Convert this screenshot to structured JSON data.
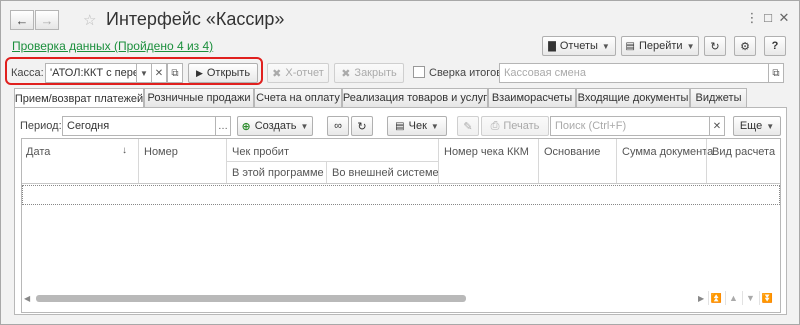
{
  "window": {
    "title": "Интерфейс «Кассир»",
    "back_icon": "arrow-left-icon",
    "forward_icon": "arrow-right-icon",
    "favorite_icon": "star-icon",
    "menu_icon": "more-vertical-icon",
    "maximize_icon": "maximize-icon",
    "close_icon": "close-icon"
  },
  "check_link": "Проверка данных (Пройдено 4 из 4)",
  "top_actions": {
    "reports": "Отчеты",
    "goto": "Перейти",
    "refresh_icon": "refresh-icon",
    "settings_icon": "gear-icon",
    "help": "?"
  },
  "cashbox": {
    "label": "Касса:",
    "value": "'АТОЛ:ККТ с переда",
    "open_button": "Открыть",
    "x_report": "Х-отчет",
    "close_shift": "Закрыть",
    "totals_check": "Сверка итогов",
    "shift_placeholder": "Кассовая смена"
  },
  "tabs": [
    "Прием/возврат платежей",
    "Розничные продажи",
    "Счета на оплату",
    "Реализация товаров и услуг",
    "Взаиморасчеты",
    "Входящие документы",
    "Виджеты"
  ],
  "filter": {
    "period_label": "Период:",
    "period_value": "Сегодня",
    "create": "Создать",
    "check": "Чек",
    "print": "Печать",
    "search_placeholder": "Поиск (Ctrl+F)",
    "more": "Еще"
  },
  "grid": {
    "headers": {
      "date": "Дата",
      "number": "Номер",
      "check_printed": "Чек пробит",
      "in_this_program": "В этой программе",
      "in_external_system": "Во внешней системе",
      "kkm_number": "Номер чека ККМ",
      "basis": "Основание",
      "doc_sum": "Сумма документа",
      "calc_type": "Вид расчета"
    },
    "rows": []
  },
  "colors": {
    "accent_red": "#e0201e",
    "link_green": "#1b8f3c",
    "window_bg": "#f2f2f2"
  }
}
